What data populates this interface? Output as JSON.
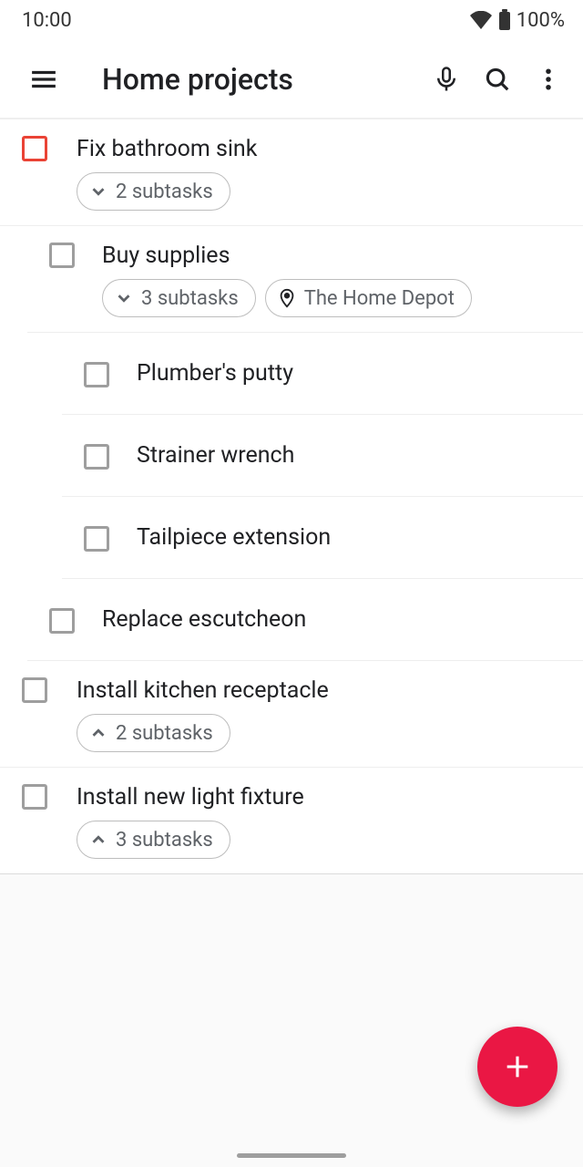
{
  "status": {
    "time": "10:00",
    "battery": "100%"
  },
  "header": {
    "title": "Home projects"
  },
  "tasks": {
    "t0": {
      "title": "Fix bathroom sink",
      "subtasks_label": "2 subtasks"
    },
    "t1": {
      "title": "Buy supplies",
      "subtasks_label": "3 subtasks",
      "location": "The Home Depot"
    },
    "t1a": {
      "title": "Plumber's putty"
    },
    "t1b": {
      "title": "Strainer wrench"
    },
    "t1c": {
      "title": "Tailpiece extension"
    },
    "t2": {
      "title": "Replace escutcheon"
    },
    "t3": {
      "title": "Install kitchen receptacle",
      "subtasks_label": "2 subtasks"
    },
    "t4": {
      "title": "Install new light fixture",
      "subtasks_label": "3 subtasks"
    }
  }
}
